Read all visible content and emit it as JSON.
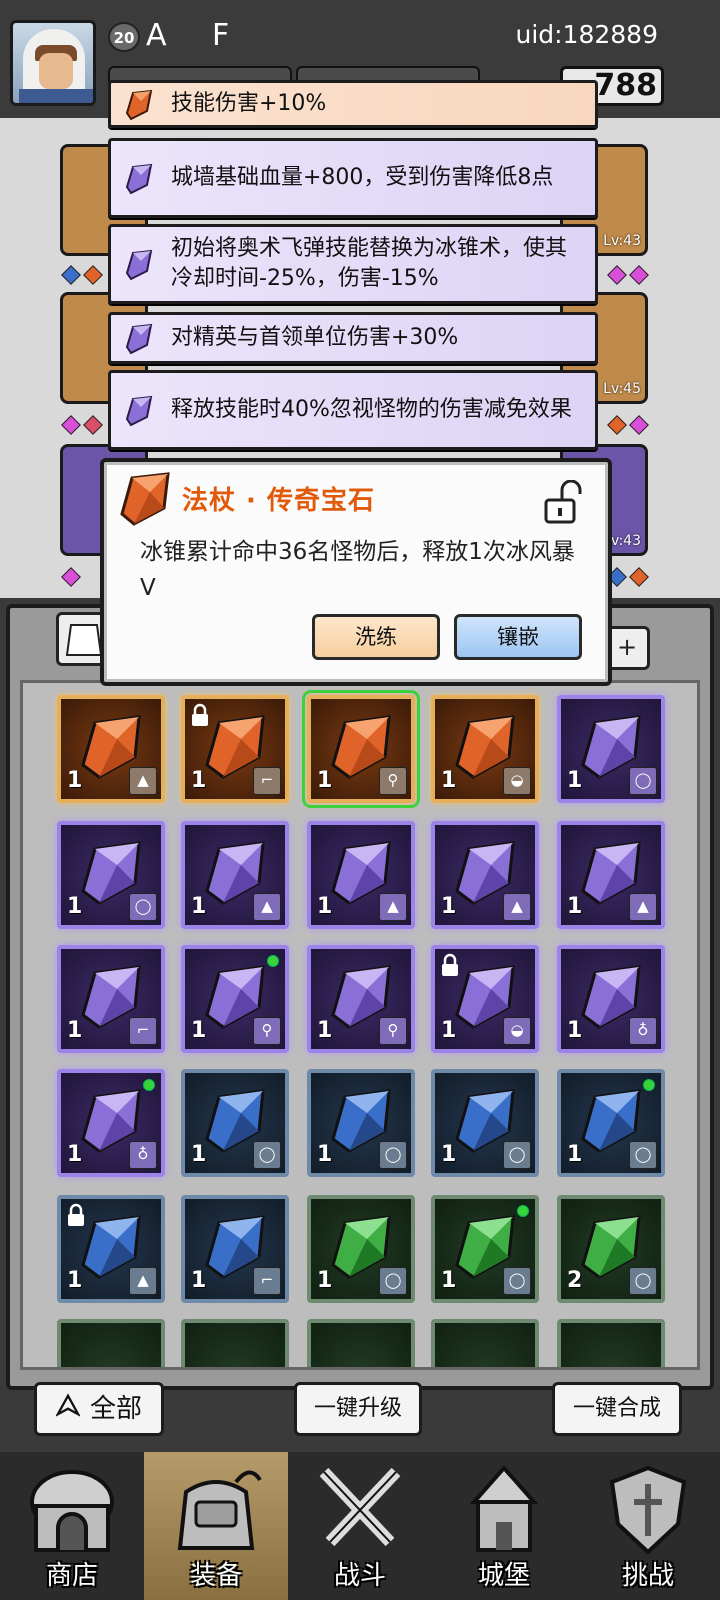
{
  "header": {
    "level": "20",
    "player_name": "A F",
    "uid": "uid:182889",
    "currency_visible": "788"
  },
  "bonuses": [
    {
      "text": "技能伤害+10%",
      "rarity": "orange"
    },
    {
      "text": "城墙基础血量+800，受到伤害降低8点",
      "rarity": "purple"
    },
    {
      "text": "初始将奥术飞弹技能替换为冰锥术，使其冷却时间-25%，伤害-15%",
      "rarity": "purple"
    },
    {
      "text": "对精英与首领单位伤害+30%",
      "rarity": "purple"
    },
    {
      "text": "释放技能时40%忽视怪物的伤害减免效果",
      "rarity": "purple"
    }
  ],
  "equipment_levels": [
    "Lv:43",
    "Lv:45",
    "Lv:43"
  ],
  "popup": {
    "title": "法杖 · 传奇宝石",
    "description": "冰锥累计命中36名怪物后，释放1次冰风暴V",
    "refine_label": "洗练",
    "inlay_label": "镶嵌",
    "lock_state": "unlocked-lock-icon"
  },
  "filter": {
    "right_symbol": "+"
  },
  "inventory": [
    [
      {
        "rarity": "orange",
        "qty": "1",
        "type": "armor",
        "locked": false,
        "new": false
      },
      {
        "rarity": "orange",
        "qty": "1",
        "type": "boots",
        "locked": true,
        "new": false
      },
      {
        "rarity": "orange",
        "qty": "1",
        "type": "staff",
        "locked": false,
        "new": false,
        "selected": true
      },
      {
        "rarity": "orange",
        "qty": "1",
        "type": "hat",
        "locked": false,
        "new": false
      },
      {
        "rarity": "purple",
        "qty": "1",
        "type": "ring",
        "locked": false,
        "new": false
      }
    ],
    [
      {
        "rarity": "purple",
        "qty": "1",
        "type": "ring",
        "locked": false,
        "new": false
      },
      {
        "rarity": "purple",
        "qty": "1",
        "type": "armor",
        "locked": false,
        "new": false
      },
      {
        "rarity": "purple",
        "qty": "1",
        "type": "armor",
        "locked": false,
        "new": false
      },
      {
        "rarity": "purple",
        "qty": "1",
        "type": "armor",
        "locked": false,
        "new": false
      },
      {
        "rarity": "purple",
        "qty": "1",
        "type": "armor",
        "locked": false,
        "new": false
      }
    ],
    [
      {
        "rarity": "purple",
        "qty": "1",
        "type": "boots",
        "locked": false,
        "new": false
      },
      {
        "rarity": "purple",
        "qty": "1",
        "type": "staff",
        "locked": false,
        "new": true
      },
      {
        "rarity": "purple",
        "qty": "1",
        "type": "staff",
        "locked": false,
        "new": false
      },
      {
        "rarity": "purple",
        "qty": "1",
        "type": "hat",
        "locked": true,
        "new": false
      },
      {
        "rarity": "purple",
        "qty": "1",
        "type": "amulet",
        "locked": false,
        "new": false
      }
    ],
    [
      {
        "rarity": "purple",
        "qty": "1",
        "type": "amulet",
        "locked": false,
        "new": true
      },
      {
        "rarity": "blue",
        "qty": "1",
        "type": "ring",
        "locked": false,
        "new": false
      },
      {
        "rarity": "blue",
        "qty": "1",
        "type": "ring",
        "locked": false,
        "new": false
      },
      {
        "rarity": "blue",
        "qty": "1",
        "type": "ring",
        "locked": false,
        "new": false
      },
      {
        "rarity": "blue",
        "qty": "1",
        "type": "ring",
        "locked": false,
        "new": true
      }
    ],
    [
      {
        "rarity": "blue",
        "qty": "1",
        "type": "armor",
        "locked": true,
        "new": false
      },
      {
        "rarity": "blue",
        "qty": "1",
        "type": "boots",
        "locked": false,
        "new": false
      },
      {
        "rarity": "green",
        "qty": "1",
        "type": "ring",
        "locked": false,
        "new": false
      },
      {
        "rarity": "green",
        "qty": "1",
        "type": "ring",
        "locked": false,
        "new": true
      },
      {
        "rarity": "green",
        "qty": "2",
        "type": "ring",
        "locked": false,
        "new": false
      }
    ]
  ],
  "bottom_buttons": {
    "all_label": "全部",
    "upgrade_label": "一键升级",
    "merge_label": "一键合成"
  },
  "nav": [
    {
      "label": "商店",
      "icon": "shop-icon"
    },
    {
      "label": "装备",
      "icon": "equipment-bag-icon",
      "active": true
    },
    {
      "label": "战斗",
      "icon": "crossed-swords-icon"
    },
    {
      "label": "城堡",
      "icon": "castle-icon"
    },
    {
      "label": "挑战",
      "icon": "challenge-shield-icon"
    }
  ],
  "colors": {
    "orange_gem": "#e0642a",
    "purple_gem": "#8a6fd6",
    "blue_gem": "#3a6fc9",
    "green_gem": "#3fae45",
    "title_orange": "#e05a0a"
  }
}
